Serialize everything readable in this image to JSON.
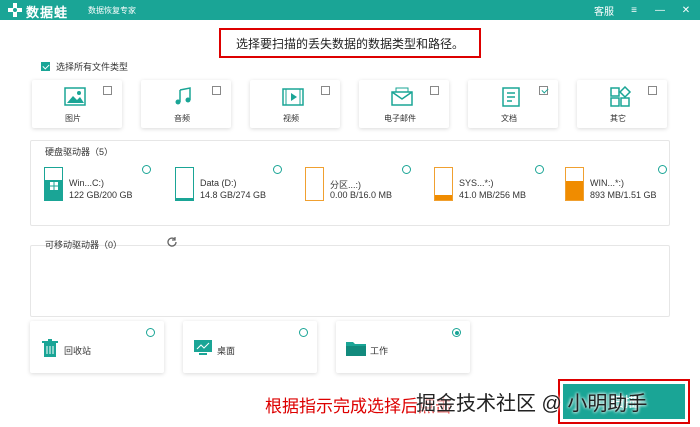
{
  "app": {
    "brand": "数据蛙",
    "subtitle": "数据恢复专家",
    "support_label": "客服",
    "window_controls": [
      "≡",
      "—",
      "✕"
    ]
  },
  "instruction": "选择要扫描的丢失数据的数据类型和路径。",
  "select_all": {
    "label": "选择所有文件类型",
    "checked": true
  },
  "file_types": [
    {
      "label": "图片",
      "icon": "image-icon",
      "checked": false
    },
    {
      "label": "音频",
      "icon": "audio-icon",
      "checked": false
    },
    {
      "label": "视频",
      "icon": "video-icon",
      "checked": false
    },
    {
      "label": "电子邮件",
      "icon": "email-icon",
      "checked": false
    },
    {
      "label": "文档",
      "icon": "document-icon",
      "checked": true
    },
    {
      "label": "其它",
      "icon": "other-icon",
      "checked": false
    }
  ],
  "hard_drives": {
    "title": "硬盘驱动器（5）",
    "items": [
      {
        "name": "Win...C:)",
        "size": "122 GB/200 GB",
        "fill": 0.61
      },
      {
        "name": "Data (D:)",
        "size": "14.8 GB/274 GB",
        "fill": 0.05
      },
      {
        "name": "分区...:)",
        "size": "0.00  B/16.0 MB",
        "fill": 0
      },
      {
        "name": "SYS...*:)",
        "size": "41.0 MB/256 MB",
        "fill": 0.16
      },
      {
        "name": "WIN...*:)",
        "size": "893 MB/1.51 GB",
        "fill": 0.59
      }
    ]
  },
  "removable": {
    "title": "可移动驱动器（0）"
  },
  "quick_locations": [
    {
      "label": "回收站",
      "icon": "recycle-bin-icon",
      "selected": false
    },
    {
      "label": "桌面",
      "icon": "desktop-icon",
      "selected": false
    },
    {
      "label": "工作",
      "icon": "folder-icon",
      "selected": true
    }
  ],
  "bottom_note": "根据指示完成选择后点击",
  "watermark": "掘金技术社区 @ 小明助手",
  "next_button": "扫描",
  "colors": {
    "accent": "#1aa596",
    "highlight": "#dd0000",
    "drive_fill_orange": "#f08c00",
    "drive_fill_teal": "#1aa596"
  }
}
